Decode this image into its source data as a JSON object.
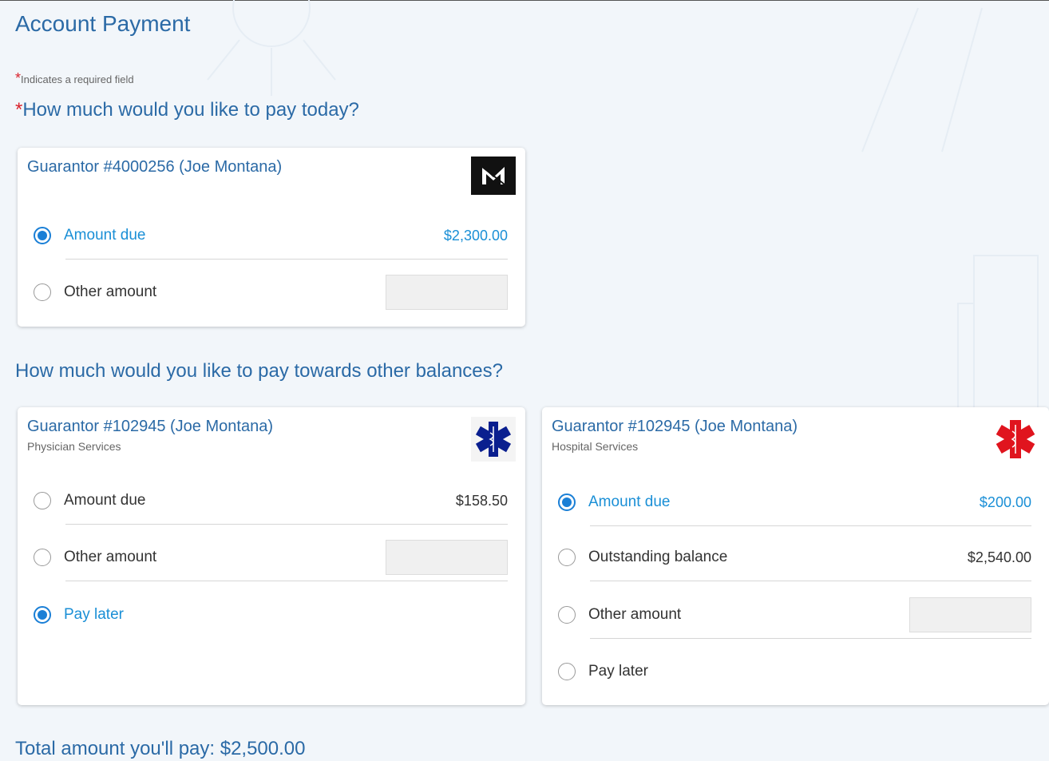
{
  "page": {
    "title": "Account Payment",
    "required_note": "Indicates a required field",
    "question_today": "How much would you like to pay today?",
    "question_other": "How much would you like to pay towards other balances?",
    "total": "Total amount you'll pay: $2,500.00"
  },
  "cards": [
    {
      "title": "Guarantor #4000256 (Joe Montana)",
      "subtitle": "",
      "logo": "m-logo-icon",
      "options": [
        {
          "label": "Amount due",
          "value": "$2,300.00",
          "selected": true
        },
        {
          "label": "Other amount",
          "input_value": "",
          "selected": false
        }
      ]
    },
    {
      "title": "Guarantor #102945 (Joe Montana)",
      "subtitle": "Physician Services",
      "logo": "star-of-life-icon",
      "logo_color": "#0a1f8f",
      "options": [
        {
          "label": "Amount due",
          "value": "$158.50",
          "selected": false
        },
        {
          "label": "Other amount",
          "input_value": "",
          "selected": false
        },
        {
          "label": "Pay later",
          "selected": true
        }
      ]
    },
    {
      "title": "Guarantor #102945 (Joe Montana)",
      "subtitle": "Hospital Services",
      "logo": "star-of-life-icon",
      "logo_color": "#e0141e",
      "options": [
        {
          "label": "Amount due",
          "value": "$200.00",
          "selected": true
        },
        {
          "label": "Outstanding balance",
          "value": "$2,540.00",
          "selected": false
        },
        {
          "label": "Other amount",
          "input_value": "",
          "selected": false
        },
        {
          "label": "Pay later",
          "selected": false
        }
      ]
    }
  ],
  "colors": {
    "heading": "#2b6aa6",
    "accent": "#1a8fd6",
    "required": "#d9232d"
  }
}
